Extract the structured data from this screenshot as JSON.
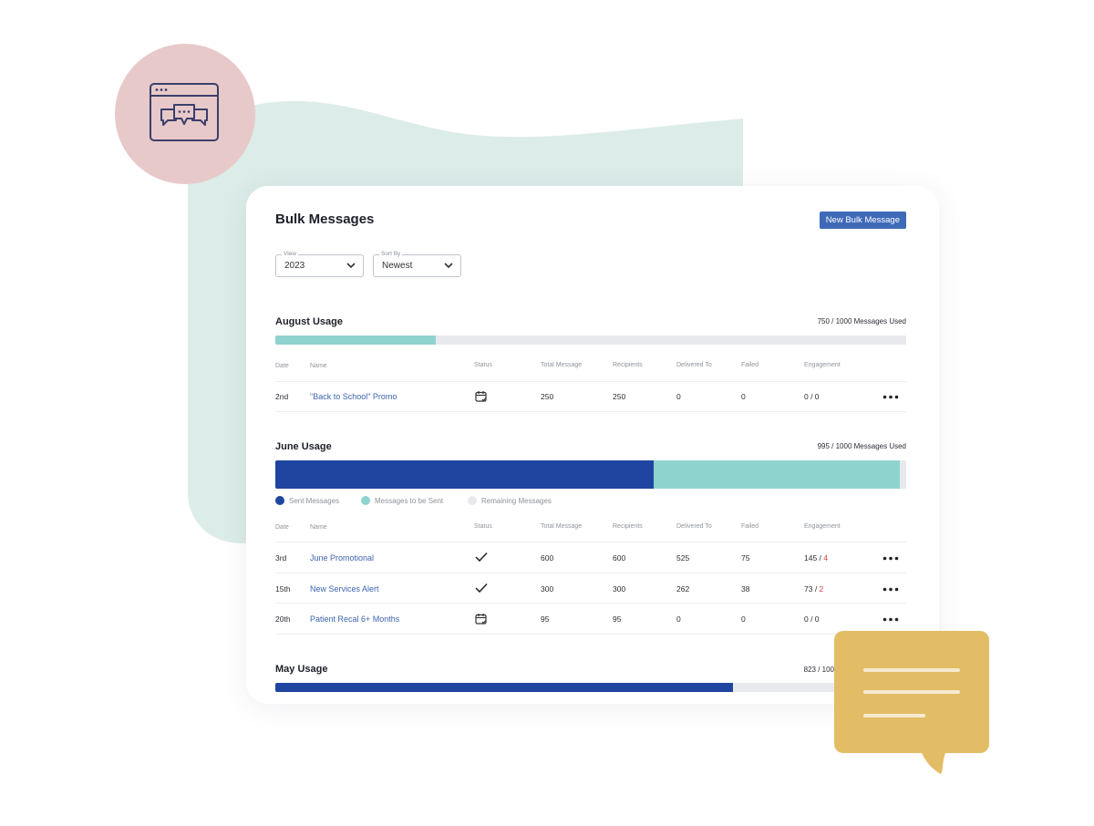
{
  "colors": {
    "accent_blue": "#1f45a0",
    "teal": "#8fd3cf",
    "light_gray": "#e7e9ec",
    "button_blue": "#3f6ab8",
    "link_blue": "#3d64b0",
    "badge_pink": "#e8c9c9",
    "blob_mint": "#dcece9",
    "bubble_gold": "#e3bd65",
    "failed_red": "#d83a3a"
  },
  "header": {
    "title": "Bulk Messages",
    "new_button_label": "New Bulk Message"
  },
  "filters": {
    "view": {
      "legend": "View",
      "value": "2023"
    },
    "sort": {
      "legend": "Sort By",
      "value": "Newest"
    }
  },
  "columns": [
    "Date",
    "Name",
    "Status",
    "Total Message",
    "Recipients",
    "Delivered To",
    "Failed",
    "Engagement"
  ],
  "legend": {
    "sent": "Sent Messages",
    "to_be_sent": "Messages to be Sent",
    "remaining": "Remaining Messages"
  },
  "sections": {
    "august": {
      "title": "August Usage",
      "usage_text": "750 / 1000 Messages Used",
      "sent_fraction": 0.0,
      "scheduled_fraction": 0.254,
      "rows": [
        {
          "date": "2nd",
          "name": "\"Back to School\" Promo",
          "status": "calendar-scheduled-icon",
          "total": "250",
          "recipients": "250",
          "delivered": "0",
          "failed": "0",
          "eng_a": "0 / 0",
          "eng_b": ""
        }
      ]
    },
    "june": {
      "title": "June Usage",
      "usage_text": "995 / 1000 Messages Used",
      "sent_fraction": 0.6,
      "scheduled_fraction": 0.39,
      "rows": [
        {
          "date": "3rd",
          "name": "June Promotional",
          "status": "checkmark-icon",
          "total": "600",
          "recipients": "600",
          "delivered": "525",
          "failed": "75",
          "eng_a": "145 / ",
          "eng_b": "4"
        },
        {
          "date": "15th",
          "name": "New Services Alert",
          "status": "checkmark-icon",
          "total": "300",
          "recipients": "300",
          "delivered": "262",
          "failed": "38",
          "eng_a": "73 / ",
          "eng_b": "2"
        },
        {
          "date": "20th",
          "name": "Patient Recal 6+ Months",
          "status": "calendar-scheduled-icon",
          "total": "95",
          "recipients": "95",
          "delivered": "0",
          "failed": "0",
          "eng_a": "0 / 0",
          "eng_b": ""
        }
      ]
    },
    "may": {
      "title": "May Usage",
      "usage_text": "823 / 100",
      "sent_fraction": 0.726
    }
  }
}
